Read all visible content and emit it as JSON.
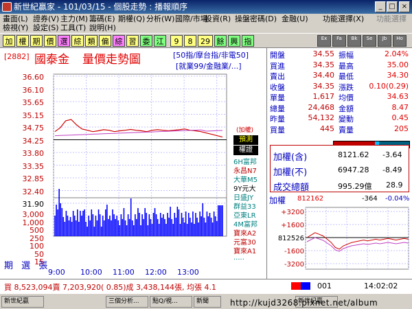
{
  "window": {
    "title": "新世紀贏家 - 101/03/15 - 個股走勢 : 播報順序"
  },
  "menu": {
    "row1": [
      "畫面(L)",
      "證券(V)",
      "主力(M)",
      "籌碼(E)",
      "期權(Q)",
      "分析(W)",
      "投資(R)",
      "操盤密碼(D)",
      "金融(U)",
      "功能選擇(X)",
      "功能選擇"
    ],
    "row2": [
      "檢視(Y)",
      "設定(S)",
      "工具(T)",
      "說明(H)"
    ],
    "row1_extra": "國際/市場"
  },
  "toolbar": {
    "buttons": [
      "加",
      "權",
      "期",
      "價",
      "選",
      "綜",
      "類",
      "偏",
      "綜",
      "習",
      "委",
      "江",
      "9",
      "8",
      "29",
      "餘",
      "興",
      "指"
    ],
    "extras": [
      "Ex",
      "Fa",
      "Bk",
      "Se",
      "Jb",
      "Ho"
    ]
  },
  "header": {
    "code": "[2882]",
    "name": "國泰金",
    "title": "量價走勢圖",
    "links1": "[50指/摩台指/非電50]",
    "links2": "[就業99/金融業/...]"
  },
  "price_axis": [
    "36.60",
    "36.10",
    "35.65",
    "35.15",
    "34.75",
    "34.25",
    "33.80",
    "33.35",
    "32.85",
    "32.40",
    "31.90"
  ],
  "volume_axis": [
    "3,000",
    "1,000",
    "500",
    "250",
    "100",
    "50",
    "15"
  ],
  "left_label": "期 選 張",
  "time_axis": [
    "9:00",
    "10:00",
    "11:00",
    "12:00",
    "13:00"
  ],
  "chart_side": {
    "tag": "(加權)",
    "btn1": "預測",
    "btn2": "權證",
    "items": [
      "6H富邦",
      "永昌N7",
      "大華M5",
      "9Y元大",
      "日盛JY",
      "群益33",
      "亞東LR",
      "4M富邦",
      "寶來A2",
      "元富30",
      "寶來A1",
      "....."
    ]
  },
  "quote": {
    "rows": [
      {
        "k1": "開盤",
        "v1": "34.55",
        "k2": "振幅",
        "v2": "2.04%"
      },
      {
        "k1": "買進",
        "v1": "34.35",
        "k2": "最高",
        "v2": "35.00"
      },
      {
        "k1": "賣出",
        "v1": "34.40",
        "k2": "最低",
        "v2": "34.30"
      },
      {
        "k1": "收盤",
        "v1": "34.35",
        "k2": "漲跌",
        "v2": "0.10(0.29)"
      },
      {
        "k1": "單量",
        "v1": "1,617",
        "k2": "均價",
        "v2": "34.63"
      },
      {
        "k1": "總量",
        "v1": "24,468",
        "k2": "金額",
        "v2": "8.47"
      },
      {
        "k1": "昨量",
        "v1": "54,132",
        "k2": "變動",
        "v2": "0.45"
      },
      {
        "k1": "買量",
        "v1": "445",
        "k2": "賣量",
        "v2": "205"
      }
    ]
  },
  "index_box": {
    "rows": [
      {
        "label": "加權(含)",
        "value": "8121.62",
        "chg": "-3.64"
      },
      {
        "label": "加權(不)",
        "value": "6947.28",
        "chg": "-8.49"
      },
      {
        "label": "成交總額",
        "value": "995.29億",
        "chg": "28.9"
      }
    ]
  },
  "mini": {
    "label": "加權",
    "value": "812162",
    "chg": "-364",
    "pct": "-0.04%",
    "axis": [
      "+3200",
      "+1600",
      "812526",
      "-1600",
      "-3200"
    ]
  },
  "status": {
    "text": "買 8,523,094賣 7,203,920( 0.85)成 3,438,144張, 均張 4.1",
    "code": "001",
    "time": "14:02:02"
  },
  "taskbar": {
    "items": [
      "新世紀贏",
      "三個分析...",
      "點Q/視...",
      "新聞",
      "新世紀贏"
    ]
  },
  "watermark": "http://kujd3268.pixnet.net/album",
  "colors": {
    "price": "#d00000",
    "avg": "#c040c0",
    "volume": "#0000ff",
    "ref": "#000000"
  }
}
